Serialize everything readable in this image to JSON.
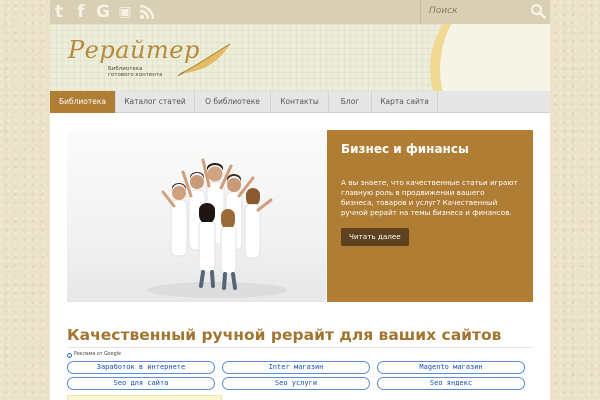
{
  "topbar": {
    "social": [
      {
        "icon": "twitter-icon",
        "glyph": "t"
      },
      {
        "icon": "facebook-icon",
        "glyph": "f"
      },
      {
        "icon": "google-plus-icon",
        "glyph": "G"
      },
      {
        "icon": "vk-icon",
        "glyph": "▣"
      },
      {
        "icon": "rss-icon",
        "glyph": "◡"
      }
    ],
    "search_placeholder": "Поиск"
  },
  "header": {
    "logo_title": "Рерайтер",
    "logo_subtitle": "Библиотека готового контента"
  },
  "nav": {
    "items": [
      {
        "label": "Библиотека",
        "active": true
      },
      {
        "label": "Каталог статей",
        "active": false
      },
      {
        "label": "О библиотеке",
        "active": false
      },
      {
        "label": "Контакты",
        "active": false
      },
      {
        "label": "Блог",
        "active": false
      },
      {
        "label": "Карта сайта",
        "active": false
      }
    ]
  },
  "slide": {
    "title": "Бизнес и финансы",
    "text": "А вы знаете, что качественные статьи играют главную роль в продвижении вашего бизнеса, товаров и услуг? Качественный ручной рерайт на темы бизнеса и финансов.",
    "button_label": "Читать далее"
  },
  "main": {
    "heading": "Качественный ручной рерайт для ваших сайтов",
    "ads_label": "Реклама от Google",
    "ads": [
      "Заработок в интернете",
      "Inter магазин",
      "Magento магазин",
      "Seo для сайта",
      "Seo услуги",
      "Seo яндекс"
    ]
  },
  "colors": {
    "accent": "#b07d35",
    "button_dark": "#5d4220",
    "heading": "#a27530",
    "ad_border": "#5a8fd8"
  }
}
